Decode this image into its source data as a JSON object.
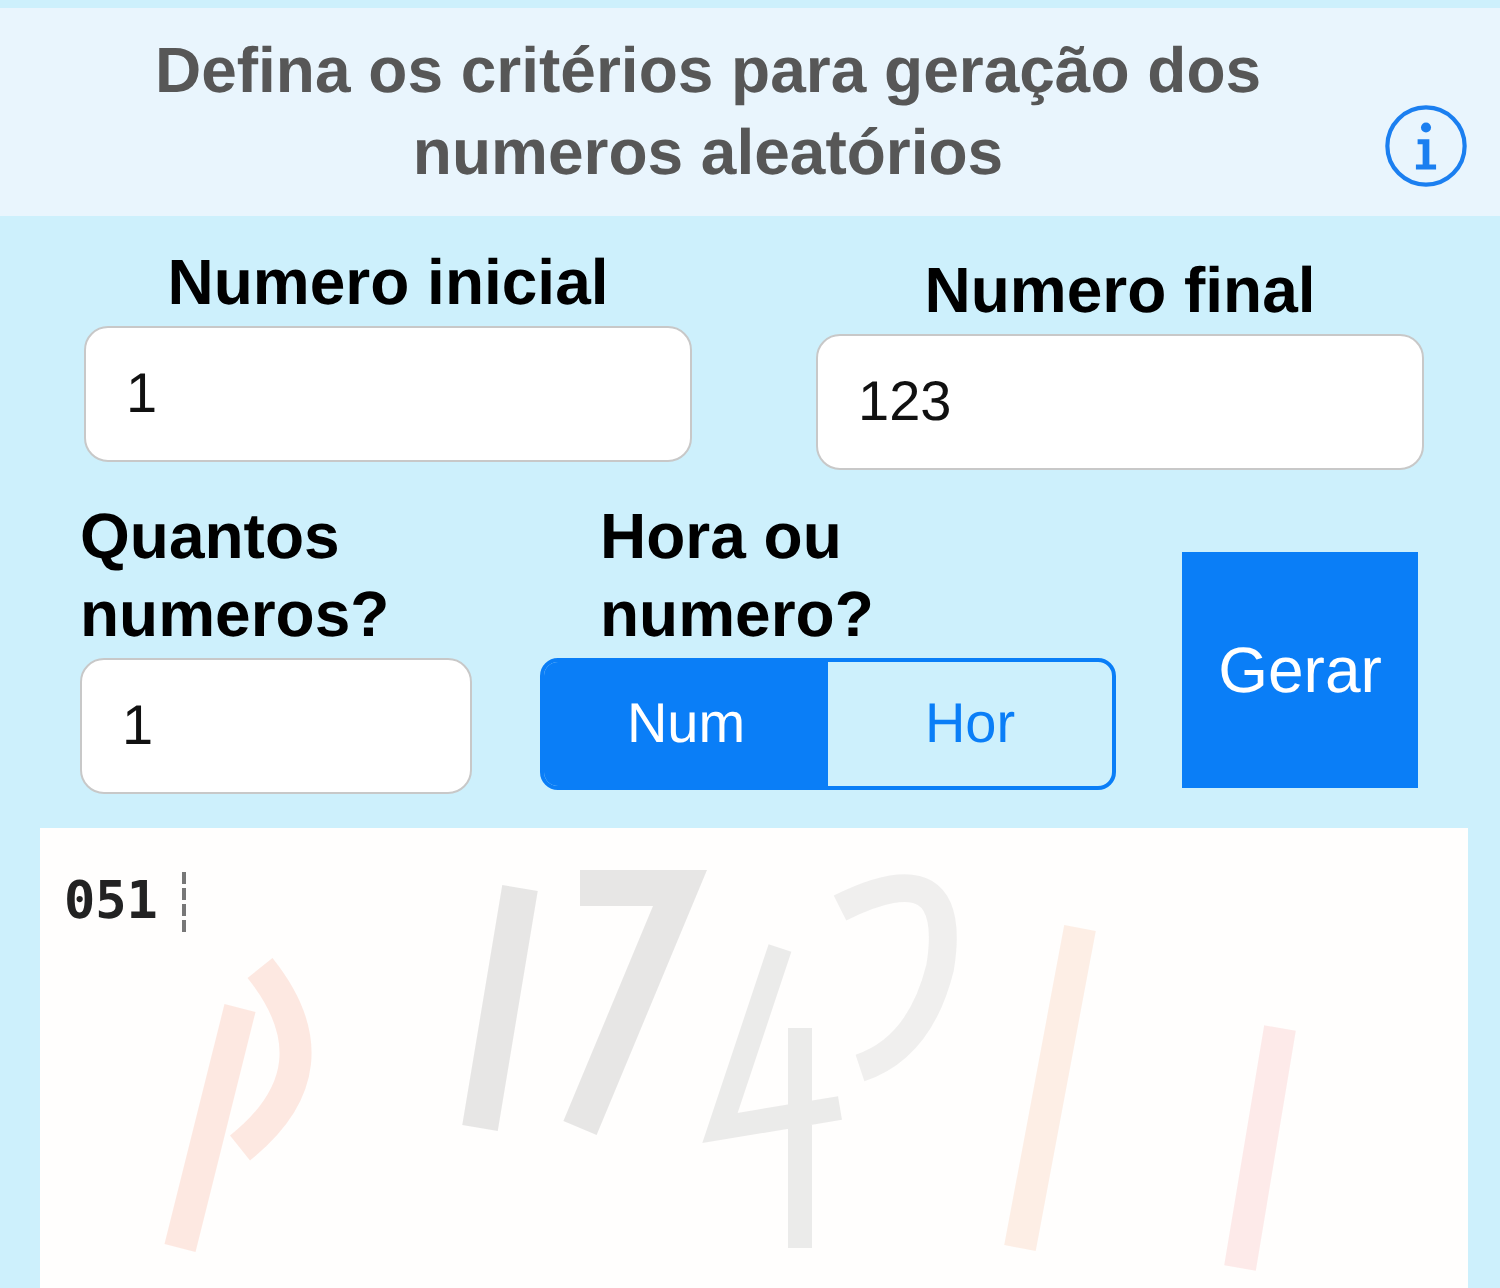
{
  "header": {
    "title": "Defina os critérios para geração dos numeros aleatórios"
  },
  "fields": [
    {
      "label": "Numero inicial",
      "value": "1"
    },
    {
      "label": "Numero final",
      "value": "123"
    }
  ],
  "count": {
    "label": "Quantos numeros?",
    "value": "1"
  },
  "mode": {
    "label": "Hora ou numero?",
    "segments": [
      {
        "label": "Num",
        "selected": true
      },
      {
        "label": "Hor",
        "selected": false
      }
    ]
  },
  "generate_button": "Gerar",
  "output": {
    "value": "051"
  }
}
